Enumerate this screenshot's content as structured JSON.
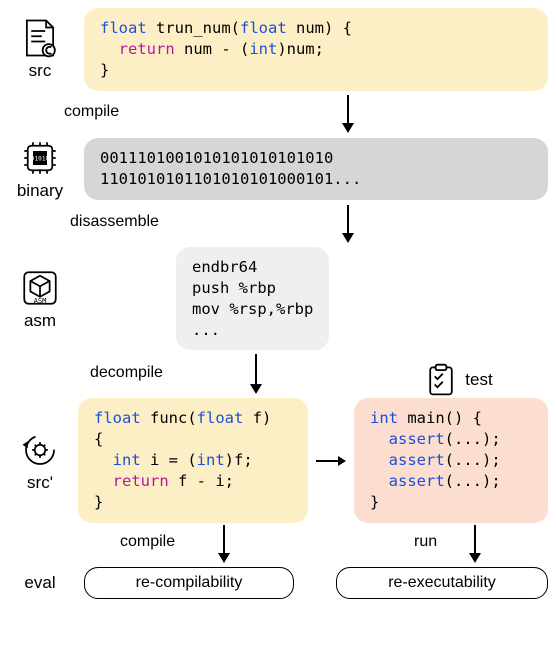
{
  "labels": {
    "src": "src",
    "binary": "binary",
    "asm": "asm",
    "srcprime": "src'",
    "test": "test",
    "eval": "eval"
  },
  "arrows": {
    "compile": "compile",
    "disassemble": "disassemble",
    "decompile": "decompile",
    "run": "run"
  },
  "code": {
    "src_l1a": "float",
    "src_l1b": " trun_num(",
    "src_l1c": "float",
    "src_l1d": " num) {",
    "src_l2a": "  return",
    "src_l2b": " num - (",
    "src_l2c": "int",
    "src_l2d": ")num;",
    "src_l3": "}",
    "bin_l1": "0011101001010101010101010",
    "bin_l2": "1101010101101010101000101...",
    "asm_l1": "endbr64",
    "asm_l2": "push %rbp",
    "asm_l3": "mov %rsp,%rbp",
    "asm_l4": "...",
    "sp_l1a": "float",
    "sp_l1b": " func(",
    "sp_l1c": "float",
    "sp_l1d": " f)",
    "sp_l2": "{",
    "sp_l3a": "  int",
    "sp_l3b": " i = (",
    "sp_l3c": "int",
    "sp_l3d": ")f;",
    "sp_l4a": "  return",
    "sp_l4b": " f - i;",
    "sp_l5": "}",
    "t_l1a": "int",
    "t_l1b": " main() {",
    "t_l2a": "  assert",
    "t_l2b": "(...);",
    "t_l3a": "  assert",
    "t_l3b": "(...);",
    "t_l4a": "  assert",
    "t_l4b": "(...);",
    "t_l5": "}"
  },
  "pills": {
    "recompile": "re-compilability",
    "reexec": "re-executability"
  }
}
